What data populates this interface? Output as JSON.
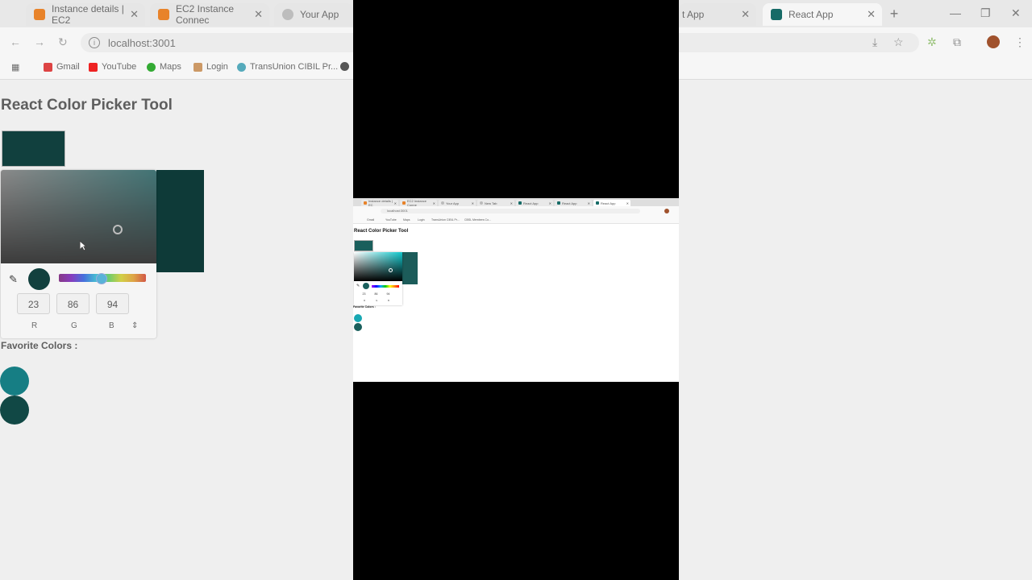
{
  "browser": {
    "tabs": [
      {
        "label": "Instance details | EC2",
        "color": "#e8832a"
      },
      {
        "label": "EC2 Instance Connec",
        "color": "#e8832a"
      },
      {
        "label": "Your App",
        "color": "#bdbdbd"
      },
      {
        "label": "t App",
        "color": "#bdbdbd"
      },
      {
        "label": "React App",
        "color": "#176b67"
      }
    ],
    "url": "localhost:3001",
    "bookmarks": [
      "Gmail",
      "YouTube",
      "Maps",
      "Login",
      "TransUnion CIBIL Pr..."
    ]
  },
  "page": {
    "title": "React Color Picker Tool",
    "swatch_color": "#11403e",
    "picker": {
      "r": "23",
      "g": "86",
      "b": "94",
      "label_r": "R",
      "label_g": "G",
      "label_b": "B",
      "mode_toggle": "⇕"
    },
    "favorites_title": "Favorite Colors :",
    "favorite_colors": [
      "#16969c",
      "#175a57"
    ]
  },
  "mini": {
    "tabs": [
      {
        "label": "Instance details | EC"
      },
      {
        "label": "EC2 Instance Conne"
      },
      {
        "label": "Your App"
      },
      {
        "label": "New Tab"
      },
      {
        "label": "React App"
      },
      {
        "label": "React App"
      },
      {
        "label": "React App"
      }
    ],
    "url": "localhost:3001",
    "bookmarks": [
      "Gmail",
      "YouTube",
      "Maps",
      "Login",
      "TransUnion CIBIL Pr...",
      "CBSL Members Co..."
    ],
    "title": "React Color Picker Tool",
    "favorites_title": "Favorite Colors :"
  }
}
